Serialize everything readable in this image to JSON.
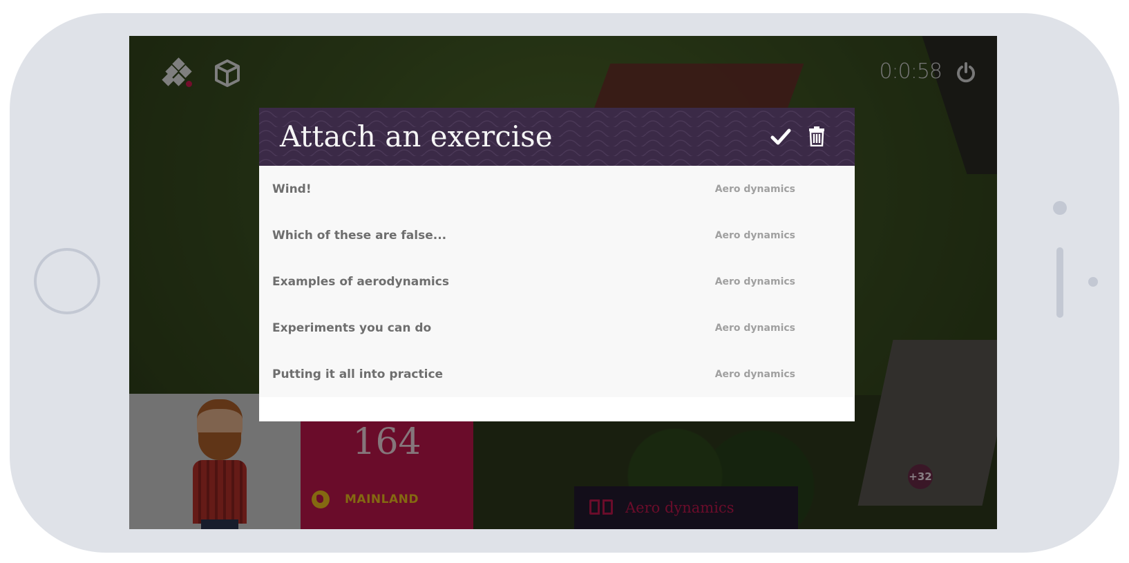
{
  "screen": {
    "timer": "0:0:58",
    "score": "164",
    "location_label": "MAINLAND",
    "extra_badge": "+32",
    "topic_chip_label": "Aero dynamics"
  },
  "modal": {
    "title": "Attach an exercise",
    "exercises": [
      {
        "title": "Wind!",
        "subject": "Aero dynamics"
      },
      {
        "title": "Which of these are false...",
        "subject": "Aero dynamics"
      },
      {
        "title": "Examples of aerodynamics",
        "subject": "Aero dynamics"
      },
      {
        "title": "Experiments you can do",
        "subject": "Aero dynamics"
      },
      {
        "title": "Putting it all into practice",
        "subject": "Aero dynamics"
      }
    ]
  },
  "icons": {
    "top_left": [
      "blocks-icon",
      "cube-icon"
    ],
    "top_right": [
      "power-icon"
    ],
    "modal_actions": [
      "check-icon",
      "trash-icon"
    ],
    "chip": "book-icon",
    "location": "globe-icon"
  },
  "colors": {
    "header": "#3b2a47",
    "accent_pink": "#c2174d",
    "accent_yellow": "#f0c020"
  }
}
